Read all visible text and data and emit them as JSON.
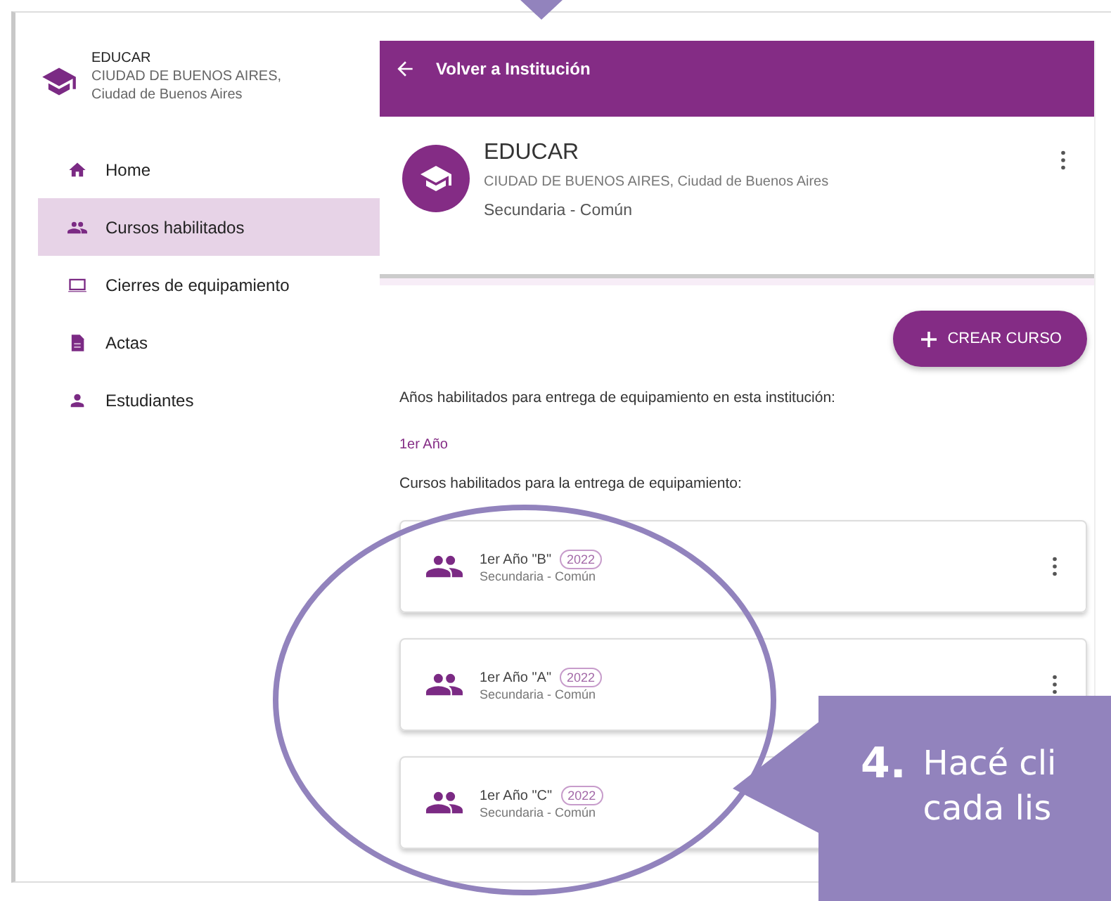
{
  "sidebar": {
    "institution": {
      "name": "EDUCAR",
      "location_line1": "CIUDAD DE BUENOS AIRES,",
      "location_line2": "Ciudad de Buenos Aires"
    },
    "items": [
      {
        "label": "Home",
        "kind": "home",
        "selected": false
      },
      {
        "label": "Cursos habilitados",
        "kind": "people",
        "selected": true
      },
      {
        "label": "Cierres de equipamiento",
        "kind": "laptop",
        "selected": false
      },
      {
        "label": "Actas",
        "kind": "document",
        "selected": false
      },
      {
        "label": "Estudiantes",
        "kind": "person",
        "selected": false
      }
    ]
  },
  "header": {
    "back_label": "Volver a Institución"
  },
  "institution_card": {
    "name": "EDUCAR",
    "location": "CIUDAD DE BUENOS AIRES, Ciudad de Buenos Aires",
    "level": "Secundaria - Común"
  },
  "create_button": {
    "label": "CREAR CURSO"
  },
  "years_heading": "Años habilitados para entrega de equipamiento en esta institución:",
  "years": [
    "1er Año"
  ],
  "courses_heading": "Cursos habilitados para la entrega de equipamiento:",
  "courses": [
    {
      "name": "1er Año \"B\"",
      "year": "2022",
      "level": "Secundaria - Común"
    },
    {
      "name": "1er Año \"A\"",
      "year": "2022",
      "level": "Secundaria - Común"
    },
    {
      "name": "1er Año \"C\"",
      "year": "2022",
      "level": "Secundaria - Común"
    }
  ],
  "callout": {
    "number": "4.",
    "lines": [
      "Hacé cli",
      "cada lis"
    ]
  }
}
